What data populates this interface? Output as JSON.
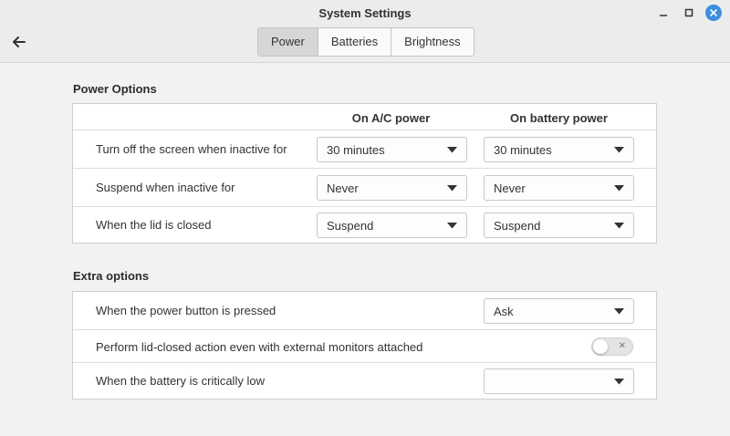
{
  "window": {
    "title": "System Settings"
  },
  "tabs": [
    {
      "label": "Power",
      "active": true
    },
    {
      "label": "Batteries",
      "active": false
    },
    {
      "label": "Brightness",
      "active": false
    }
  ],
  "power_options": {
    "title": "Power Options",
    "col_ac": "On A/C power",
    "col_battery": "On battery power",
    "rows": [
      {
        "label": "Turn off the screen when inactive for",
        "ac": "30 minutes",
        "battery": "30 minutes"
      },
      {
        "label": "Suspend when inactive for",
        "ac": "Never",
        "battery": "Never"
      },
      {
        "label": "When the lid is closed",
        "ac": "Suspend",
        "battery": "Suspend"
      }
    ]
  },
  "extra_options": {
    "title": "Extra options",
    "power_button": {
      "label": "When the power button is pressed",
      "value": "Ask"
    },
    "lid_external": {
      "label": "Perform lid-closed action even with external monitors attached",
      "enabled": false
    },
    "battery_low": {
      "label": "When the battery is critically low",
      "value": ""
    }
  },
  "colors": {
    "accent": "#3d8ee0",
    "active_tab": "#d6d6d6"
  }
}
